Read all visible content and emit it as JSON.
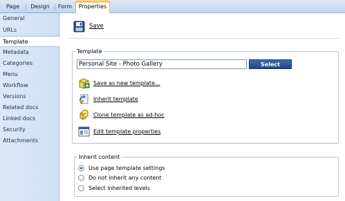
{
  "tabs": [
    {
      "label": "Page"
    },
    {
      "label": "Design"
    },
    {
      "label": "Form"
    },
    {
      "label": "Properties",
      "active": true
    }
  ],
  "sidebar": {
    "items": [
      {
        "label": "General"
      },
      {
        "label": "URLs"
      },
      {
        "label": "Template",
        "active": true
      },
      {
        "label": "Metadata"
      },
      {
        "label": "Categories"
      },
      {
        "label": "Menu"
      },
      {
        "label": "Workflow"
      },
      {
        "label": "Versions"
      },
      {
        "label": "Related docs"
      },
      {
        "label": "Linked docs"
      },
      {
        "label": "Security"
      },
      {
        "label": "Attachments"
      }
    ]
  },
  "toolbar": {
    "save_label": "Save",
    "save_icon": "floppy-disk-icon"
  },
  "template": {
    "legend": "Template",
    "value": "Personal Site - Photo Gallery",
    "select_label": "Select",
    "actions": [
      {
        "label": "Save as new template...",
        "icon": "save-template-icon"
      },
      {
        "label": "Inherit template",
        "icon": "inherit-template-icon"
      },
      {
        "label": "Clone template as ad-hoc",
        "icon": "clone-template-icon"
      },
      {
        "label": "Edit template properties",
        "icon": "edit-template-icon"
      }
    ]
  },
  "inherit": {
    "legend": "Inherit content",
    "options": [
      {
        "label": "Use page template settings",
        "checked": true
      },
      {
        "label": "Do not inherit any content",
        "checked": false
      },
      {
        "label": "Select inherited levels",
        "checked": false
      }
    ]
  },
  "colors": {
    "tab_active_border": "#e9b63c",
    "select_button": "#2c5293",
    "sidebar_bg": "#d6e4f6"
  }
}
